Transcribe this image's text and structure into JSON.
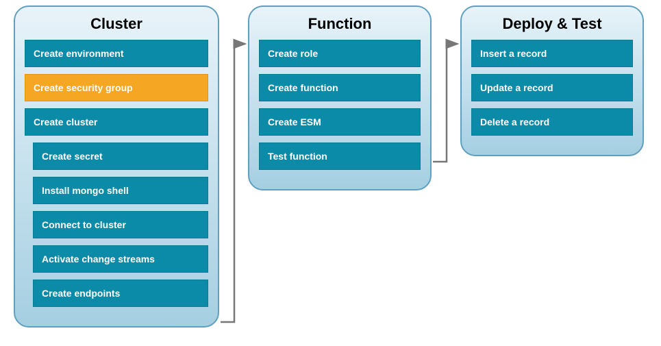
{
  "panels": {
    "cluster": {
      "title": "Cluster",
      "steps": [
        {
          "label": "Create environment",
          "highlight": false,
          "indent": 0
        },
        {
          "label": "Create security group",
          "highlight": true,
          "indent": 0
        },
        {
          "label": "Create cluster",
          "highlight": false,
          "indent": 0
        },
        {
          "label": "Create secret",
          "highlight": false,
          "indent": 1
        },
        {
          "label": "Install mongo shell",
          "highlight": false,
          "indent": 1
        },
        {
          "label": "Connect to cluster",
          "highlight": false,
          "indent": 1
        },
        {
          "label": "Activate change streams",
          "highlight": false,
          "indent": 1
        },
        {
          "label": "Create endpoints",
          "highlight": false,
          "indent": 1
        }
      ]
    },
    "function": {
      "title": "Function",
      "steps": [
        {
          "label": "Create role",
          "highlight": false,
          "indent": 0
        },
        {
          "label": "Create function",
          "highlight": false,
          "indent": 0
        },
        {
          "label": "Create ESM",
          "highlight": false,
          "indent": 0
        },
        {
          "label": "Test function",
          "highlight": false,
          "indent": 0
        }
      ]
    },
    "deploy": {
      "title": "Deploy & Test",
      "steps": [
        {
          "label": "Insert a record",
          "highlight": false,
          "indent": 0
        },
        {
          "label": "Update a record",
          "highlight": false,
          "indent": 0
        },
        {
          "label": "Delete a record",
          "highlight": false,
          "indent": 0
        }
      ]
    }
  },
  "arrows": [
    {
      "from": "cluster",
      "to": "function"
    },
    {
      "from": "function",
      "to": "deploy"
    }
  ]
}
